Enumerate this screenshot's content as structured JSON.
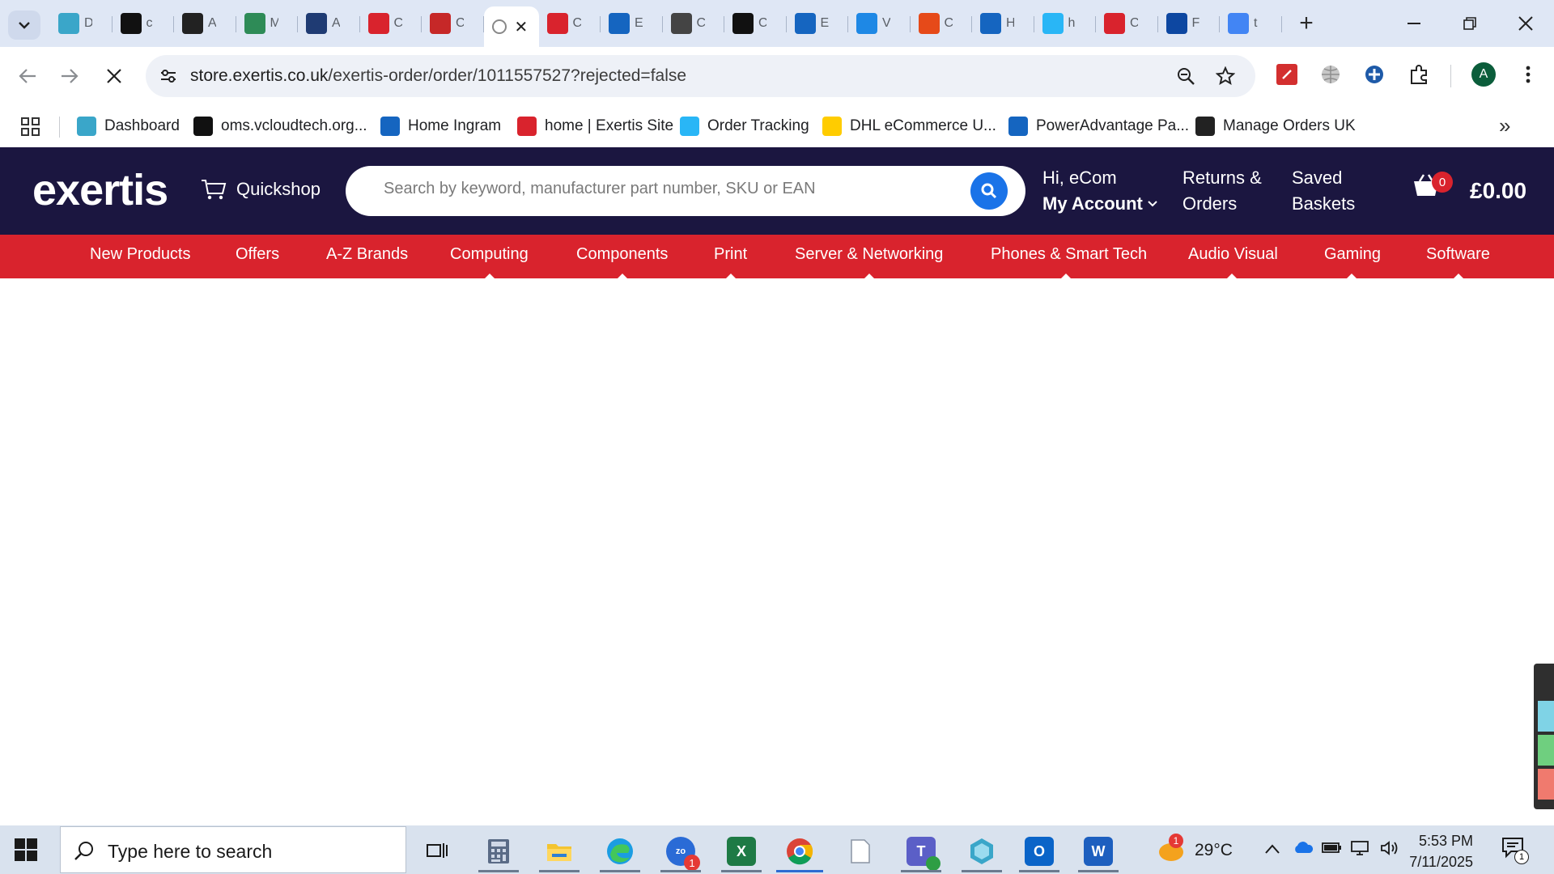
{
  "browser": {
    "tabs": [
      {
        "letter": "D",
        "icon": "hex-icon",
        "color": "#3aa6c9"
      },
      {
        "letter": "c",
        "icon": "triangle-logo-icon",
        "color": "#111111"
      },
      {
        "letter": "A",
        "icon": "amazon-icon",
        "color": "#222222"
      },
      {
        "letter": "M",
        "icon": "leaf-icon",
        "color": "#2e8b57"
      },
      {
        "letter": "A",
        "icon": "arrow-play-icon",
        "color": "#1f3b73"
      },
      {
        "letter": "C",
        "icon": "exertis-ex-icon",
        "color": "#d9232d"
      },
      {
        "letter": "C",
        "icon": "target-icon",
        "color": "#c62828"
      },
      {
        "letter": "",
        "icon": "active-tab-icon",
        "color": "#888888",
        "active": true
      },
      {
        "letter": "C",
        "icon": "exertis-ex-icon",
        "color": "#d9232d"
      },
      {
        "letter": "E",
        "icon": "e-square-icon",
        "color": "#1565c0"
      },
      {
        "letter": "C",
        "icon": "openai-icon",
        "color": "#444444"
      },
      {
        "letter": "C",
        "icon": "openai-dark-icon",
        "color": "#111111"
      },
      {
        "letter": "E",
        "icon": "e-square-icon",
        "color": "#1565c0"
      },
      {
        "letter": "V",
        "icon": "bars-icon",
        "color": "#1e88e5"
      },
      {
        "letter": "C",
        "icon": "stack-icon",
        "color": "#e64a19"
      },
      {
        "letter": "H",
        "icon": "ingram-icon",
        "color": "#1565c0"
      },
      {
        "letter": "h",
        "icon": "c-circle-icon",
        "color": "#29b6f6"
      },
      {
        "letter": "C",
        "icon": "exertis-ex-icon",
        "color": "#d9232d"
      },
      {
        "letter": "F",
        "icon": "etn-icon",
        "color": "#0d47a1"
      },
      {
        "letter": "t",
        "icon": "google-icon",
        "color": "#4285f4"
      }
    ],
    "active_close": "✕",
    "new_tab": "+",
    "url_host": "store.exertis.co.uk",
    "url_path": "/exertis-order/order/1011557527?rejected=false",
    "profile_initial": "A",
    "bookmarks": [
      {
        "label": "Dashboard",
        "icon": "hex-icon",
        "color": "#3aa6c9"
      },
      {
        "label": "oms.vcloudtech.org...",
        "icon": "triangle-logo-icon",
        "color": "#111111"
      },
      {
        "label": "Home Ingram",
        "icon": "ingram-icon",
        "color": "#1565c0"
      },
      {
        "label": "home | Exertis Site",
        "icon": "exertis-ex-icon",
        "color": "#d9232d"
      },
      {
        "label": "Order Tracking",
        "icon": "c-circle-icon",
        "color": "#29b6f6"
      },
      {
        "label": "DHL eCommerce U...",
        "icon": "dhl-icon",
        "color": "#ffcc00"
      },
      {
        "label": "PowerAdvantage Pa...",
        "icon": "flag-icon",
        "color": "#1565c0"
      },
      {
        "label": "Manage Orders UK",
        "icon": "amazon-icon",
        "color": "#222222"
      }
    ],
    "bookmarks_overflow": "»"
  },
  "site": {
    "logo": "exertis",
    "quickshop": "Quickshop",
    "search_placeholder": "Search by keyword, manufacturer part number, SKU or EAN",
    "greeting": "Hi, eCom",
    "account": "My Account",
    "returns_line1": "Returns &",
    "returns_line2": "Orders",
    "saved_line1": "Saved",
    "saved_line2": "Baskets",
    "cart_count": "0",
    "cart_total": "£0.00",
    "categories": [
      "New Products",
      "Offers",
      "A-Z Brands",
      "Computing",
      "Components",
      "Print",
      "Server & Networking",
      "Phones & Smart Tech",
      "Audio Visual",
      "Gaming",
      "Software"
    ]
  },
  "taskbar": {
    "search_placeholder": "Type here to search",
    "temperature": "29°C",
    "weather_badge": "1",
    "zoom_badge": "1",
    "time": "5:53 PM",
    "date": "7/11/2025",
    "notif_count": "1"
  },
  "colors": {
    "header_bg": "#1b1640",
    "nav_red": "#d9232d",
    "search_blue": "#1a73e8"
  }
}
